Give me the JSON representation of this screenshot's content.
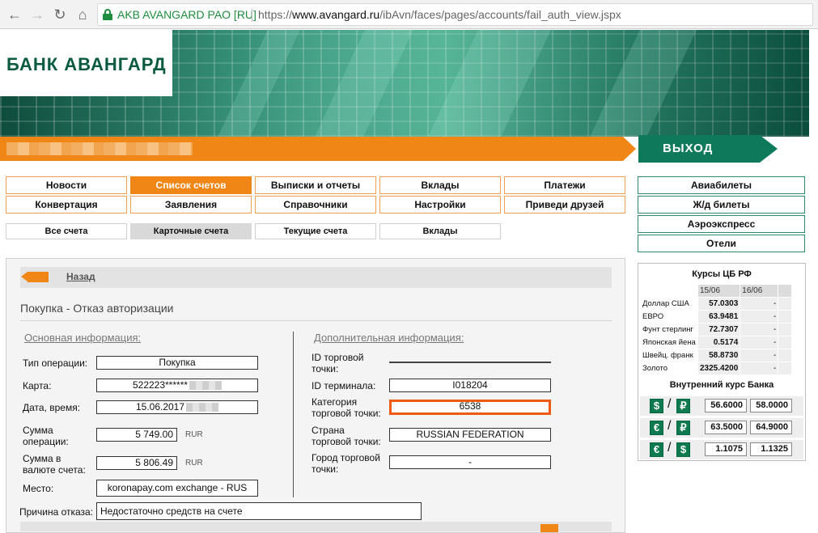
{
  "browser": {
    "secure_label": "AKB AVANGARD PAO [RU]",
    "url_scheme": "https://",
    "url_host": "www.avangard.ru",
    "url_path": "/ibAvn/faces/pages/accounts/fail_auth_view.jspx"
  },
  "header": {
    "logo": "БАНК АВАНГАРД",
    "exit_label": "ВЫХОД"
  },
  "main_menu": [
    [
      "Новости",
      "Список счетов",
      "Выписки и отчеты",
      "Вклады",
      "Платежи"
    ],
    [
      "Конвертация",
      "Заявления",
      "Справочники",
      "Настройки",
      "Приведи друзей"
    ]
  ],
  "main_menu_active": "Список счетов",
  "sub_menu": [
    "Все счета",
    "Карточные счета",
    "Текущие счета",
    "Вклады"
  ],
  "sub_menu_active": "Карточные счета",
  "side_menu": [
    "Авиабилеты",
    "Ж/д билеты",
    "Аэроэкспресс",
    "Отели"
  ],
  "page": {
    "back_label": "Назад",
    "title": "Покупка - Отказ авторизации",
    "main_section": "Основная информация:",
    "extra_section": "Дополнительная информация:",
    "fields": {
      "op_type_label": "Тип операции:",
      "op_type_value": "Покупка",
      "card_label": "Карта:",
      "card_value": "522223******",
      "datetime_label": "Дата, время:",
      "datetime_value": "15.06.2017",
      "op_sum_label_1": "Сумма",
      "op_sum_label_2": "операции:",
      "op_sum_value": "5 749.00",
      "op_sum_currency": "RUR",
      "acc_sum_label_1": "Сумма в",
      "acc_sum_label_2": "валюте счета:",
      "acc_sum_value": "5 806.49",
      "acc_sum_currency": "RUR",
      "place_label": "Место:",
      "place_value": "koronapay.com exchange - RUS",
      "merchant_id_label_1": "ID торговой",
      "merchant_id_label_2": "точки:",
      "merchant_id_value": "",
      "terminal_label": "ID терминала:",
      "terminal_value": "I018204",
      "category_label_1": "Категория",
      "category_label_2": "торговой точки:",
      "category_value": "6538",
      "country_label_1": "Страна",
      "country_label_2": "торговой точки:",
      "country_value": "RUSSIAN FEDERATION",
      "city_label_1": "Город торговой",
      "city_label_2": "точки:",
      "city_value": "-",
      "reason_label": "Причина отказа:",
      "reason_value": "Недостаточно средств на счете"
    }
  },
  "rates": {
    "title": "Курсы ЦБ РФ",
    "date1": "15/06",
    "date2": "16/06",
    "rows": [
      {
        "name": "Доллар США",
        "v1": "57.0303",
        "v2": "-"
      },
      {
        "name": "ЕВРО",
        "v1": "63.9481",
        "v2": "-"
      },
      {
        "name": "Фунт стерлинг",
        "v1": "72.7307",
        "v2": "-"
      },
      {
        "name": "Японская йена",
        "v1": "0.5174",
        "v2": "-"
      },
      {
        "name": "Швейц. франк",
        "v1": "58.8730",
        "v2": "-"
      },
      {
        "name": "Золото",
        "v1": "2325.4200",
        "v2": "-"
      }
    ],
    "internal_title": "Внутренний курс Банка",
    "internal": [
      {
        "from": "$",
        "to": "₽",
        "buy": "56.6000",
        "sell": "58.0000"
      },
      {
        "from": "€",
        "to": "₽",
        "buy": "63.5000",
        "sell": "64.9000"
      },
      {
        "from": "€",
        "to": "$",
        "buy": "1.1075",
        "sell": "1.1325"
      }
    ]
  }
}
